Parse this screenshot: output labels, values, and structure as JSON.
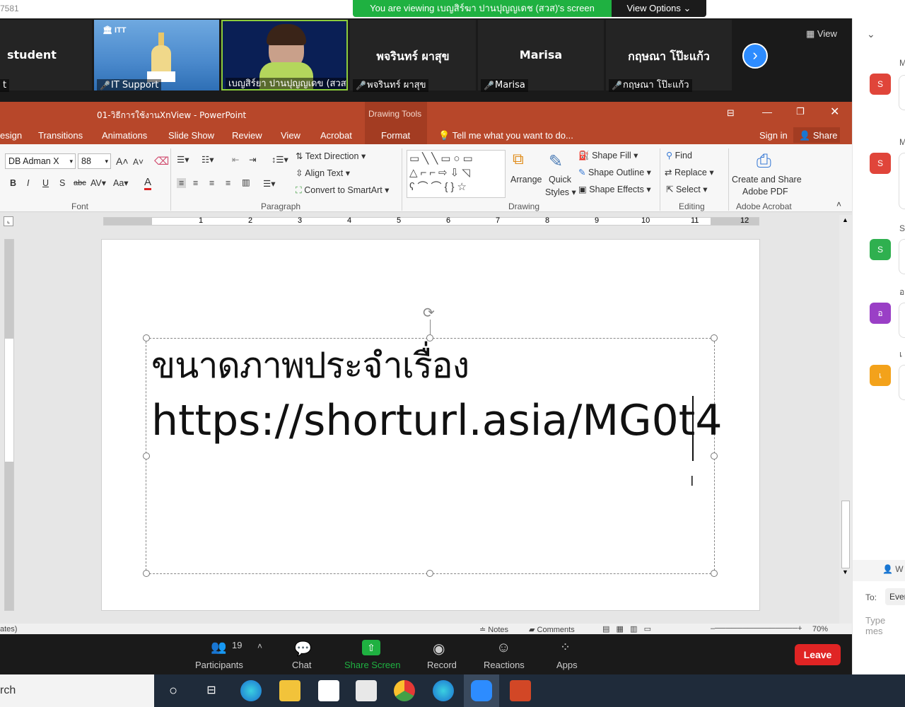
{
  "zoom": {
    "meeting_id": "7581",
    "banner": "You are viewing เบญสิร์ฆา ปานปุญญเดช (สวส)'s screen",
    "view_options": "View Options",
    "gallery_view": "View",
    "tiles": [
      {
        "name": "student",
        "label": ""
      },
      {
        "name": "",
        "label": "IT Support"
      },
      {
        "name": "",
        "label": "เบญสิร์ยา ปานปุญญเดข (สวส)"
      },
      {
        "name": "พจรินทร์ ผาสุข",
        "label": "พจรินทร์ ผาสุข"
      },
      {
        "name": "Marisa",
        "label": "Marisa"
      },
      {
        "name": "กฤษณา โป๊ะแก้ว",
        "label": "กฤษณา โป๊ะแก้ว"
      }
    ],
    "toolbar": {
      "participants_count": "19",
      "participants": "Participants",
      "chat": "Chat",
      "share_screen": "Share Screen",
      "record": "Record",
      "reactions": "Reactions",
      "apps": "Apps",
      "leave": "Leave"
    },
    "chat_panel": {
      "to_label": "To:",
      "to_value": "Ever",
      "type_placeholder": "Type mes",
      "avatars": [
        {
          "letter": "S",
          "color": "#e0453a",
          "initial": "M"
        },
        {
          "letter": "S",
          "color": "#e0453a",
          "initial": "M"
        },
        {
          "letter": "S",
          "color": "#2fb04f",
          "initial": "S"
        },
        {
          "letter": "อ",
          "color": "#9a3fc6",
          "initial": "อ"
        },
        {
          "letter": "เ",
          "color": "#f3a21b",
          "initial": "เ"
        }
      ],
      "who_label": "W"
    }
  },
  "ppt": {
    "title": "01-วิธีการใช้งานXnView - PowerPoint",
    "drawing_tools": "Drawing Tools",
    "tabs": [
      "esign",
      "Transitions",
      "Animations",
      "Slide Show",
      "Review",
      "View",
      "Acrobat",
      "Format"
    ],
    "tell_me": "Tell me what you want to do...",
    "sign_in": "Sign in",
    "share": "Share",
    "font_name": "DB Adman X",
    "font_size": "88",
    "groups": {
      "font": "Font",
      "paragraph": "Paragraph",
      "drawing": "Drawing",
      "editing": "Editing",
      "adobe": "Adobe Acrobat"
    },
    "paragraph_items": [
      "Text Direction",
      "Align Text",
      "Convert to SmartArt"
    ],
    "drawing_items": {
      "arrange": "Arrange",
      "quick": "Quick",
      "styles": "Styles",
      "fill": "Shape Fill",
      "outline": "Shape Outline",
      "effects": "Shape Effects"
    },
    "editing_items": [
      "Find",
      "Replace",
      "Select"
    ],
    "adobe_items": [
      "Create and Share",
      "Adobe PDF"
    ],
    "ruler_numbers": [
      "2",
      "1",
      "1",
      "2",
      "3",
      "4",
      "5",
      "6",
      "7",
      "8",
      "9",
      "10",
      "11",
      "12"
    ],
    "slide_line1": "ขนาดภาพประจำเรื่อง",
    "slide_line2": "https://shorturl.asia/MG0t4",
    "status": {
      "left": "ates)",
      "notes": "Notes",
      "comments": "Comments",
      "zoom": "70%"
    }
  },
  "taskbar": {
    "search": "rch"
  }
}
